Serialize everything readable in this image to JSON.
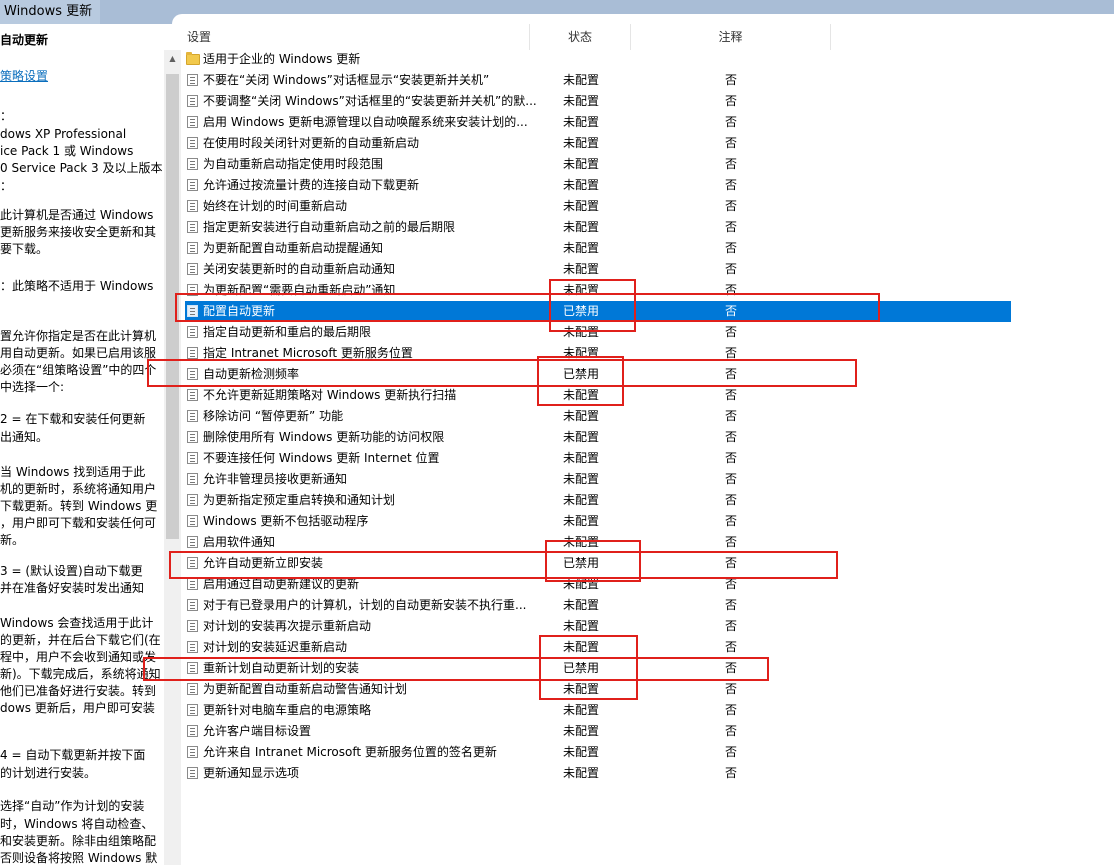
{
  "window": {
    "title": "Windows 更新"
  },
  "description": {
    "title": "自动更新",
    "link": "策略设置",
    "lines": [
      "：",
      "dows XP Professional",
      "ice Pack 1 或 Windows",
      "0 Service Pack 3 及以上版本",
      "：",
      "此计算机是否通过 Windows",
      "更新服务来接收安全更新和其",
      "要下载。",
      "：此策略不适用于 Windows",
      "置允许你指定是否在此计算机",
      "用自动更新。如果已启用该服",
      "必须在“组策略设置”中的四个",
      "中选择一个:",
      " 2 = 在下载和安装任何更新",
      "出通知。",
      " 当 Windows 找到适用于此",
      "机的更新时，系统将通知用户",
      "下载更新。转到 Windows 更",
      "，用户即可下载和安装任何可",
      "新。",
      " 3 = (默认设置)自动下载更",
      "并在准备好安装时发出通知",
      " Windows 会查找适用于此计",
      "的更新，并在后台下载它们(在",
      "程中，用户不会收到通知或发",
      "新)。下载完成后，系统将通知",
      "他们已准备好进行安装。转到",
      "dows 更新后，用户即可安装",
      " 4 = 自动下载更新并按下面",
      "的计划进行安装。",
      " 选择“自动”作为计划的安装",
      "时，Windows 将自动检查、",
      "和安装更新。除非由组策略配",
      "否则设备将按照 Windows 默"
    ]
  },
  "table": {
    "headers": {
      "setting": "设置",
      "state": "状态",
      "note": "注释"
    },
    "rows": [
      {
        "name": "适用于企业的 Windows 更新",
        "state": "",
        "note": "",
        "folder": true
      },
      {
        "name": "不要在“关闭 Windows”对话框显示“安装更新并关机”",
        "state": "未配置",
        "note": "否"
      },
      {
        "name": "不要调整“关闭 Windows”对话框里的“安装更新并关机”的默...",
        "state": "未配置",
        "note": "否"
      },
      {
        "name": "启用 Windows 更新电源管理以自动唤醒系统来安装计划的...",
        "state": "未配置",
        "note": "否"
      },
      {
        "name": "在使用时段关闭针对更新的自动重新启动",
        "state": "未配置",
        "note": "否"
      },
      {
        "name": "为自动重新启动指定使用时段范围",
        "state": "未配置",
        "note": "否"
      },
      {
        "name": "允许通过按流量计费的连接自动下载更新",
        "state": "未配置",
        "note": "否"
      },
      {
        "name": "始终在计划的时间重新启动",
        "state": "未配置",
        "note": "否"
      },
      {
        "name": "指定更新安装进行自动重新启动之前的最后期限",
        "state": "未配置",
        "note": "否"
      },
      {
        "name": "为更新配置自动重新启动提醒通知",
        "state": "未配置",
        "note": "否"
      },
      {
        "name": "关闭安装更新时的自动重新启动通知",
        "state": "未配置",
        "note": "否"
      },
      {
        "name": "为更新配置“需要自动重新启动”通知",
        "state": "未配置",
        "note": "否"
      },
      {
        "name": "配置自动更新",
        "state": "已禁用",
        "note": "否",
        "selected": true
      },
      {
        "name": "指定自动更新和重启的最后期限",
        "state": "未配置",
        "note": "否"
      },
      {
        "name": "指定 Intranet Microsoft 更新服务位置",
        "state": "未配置",
        "note": "否"
      },
      {
        "name": "自动更新检测频率",
        "state": "已禁用",
        "note": "否"
      },
      {
        "name": "不允许更新延期策略对 Windows 更新执行扫描",
        "state": "未配置",
        "note": "否"
      },
      {
        "name": "移除访问 “暂停更新” 功能",
        "state": "未配置",
        "note": "否"
      },
      {
        "name": "删除使用所有 Windows 更新功能的访问权限",
        "state": "未配置",
        "note": "否"
      },
      {
        "name": "不要连接任何 Windows 更新 Internet 位置",
        "state": "未配置",
        "note": "否"
      },
      {
        "name": "允许非管理员接收更新通知",
        "state": "未配置",
        "note": "否"
      },
      {
        "name": "为更新指定预定重启转换和通知计划",
        "state": "未配置",
        "note": "否"
      },
      {
        "name": "Windows 更新不包括驱动程序",
        "state": "未配置",
        "note": "否"
      },
      {
        "name": "启用软件通知",
        "state": "未配置",
        "note": "否"
      },
      {
        "name": "允许自动更新立即安装",
        "state": "已禁用",
        "note": "否"
      },
      {
        "name": "启用通过自动更新建议的更新",
        "state": "未配置",
        "note": "否"
      },
      {
        "name": "对于有已登录用户的计算机，计划的自动更新安装不执行重...",
        "state": "未配置",
        "note": "否"
      },
      {
        "name": "对计划的安装再次提示重新启动",
        "state": "未配置",
        "note": "否"
      },
      {
        "name": "对计划的安装延迟重新启动",
        "state": "未配置",
        "note": "否"
      },
      {
        "name": "重新计划自动更新计划的安装",
        "state": "已禁用",
        "note": "否"
      },
      {
        "name": "为更新配置自动重新启动警告通知计划",
        "state": "未配置",
        "note": "否"
      },
      {
        "name": "更新针对电脑车重启的电源策略",
        "state": "未配置",
        "note": "否"
      },
      {
        "name": "允许客户端目标设置",
        "state": "未配置",
        "note": "否"
      },
      {
        "name": "允许来自 Intranet Microsoft 更新服务位置的签名更新",
        "state": "未配置",
        "note": "否"
      },
      {
        "name": "更新通知显示选项",
        "state": "未配置",
        "note": "否"
      }
    ]
  },
  "colors": {
    "selection": "#0078d7",
    "annotation": "#e0201b",
    "link": "#0a6ebd"
  }
}
